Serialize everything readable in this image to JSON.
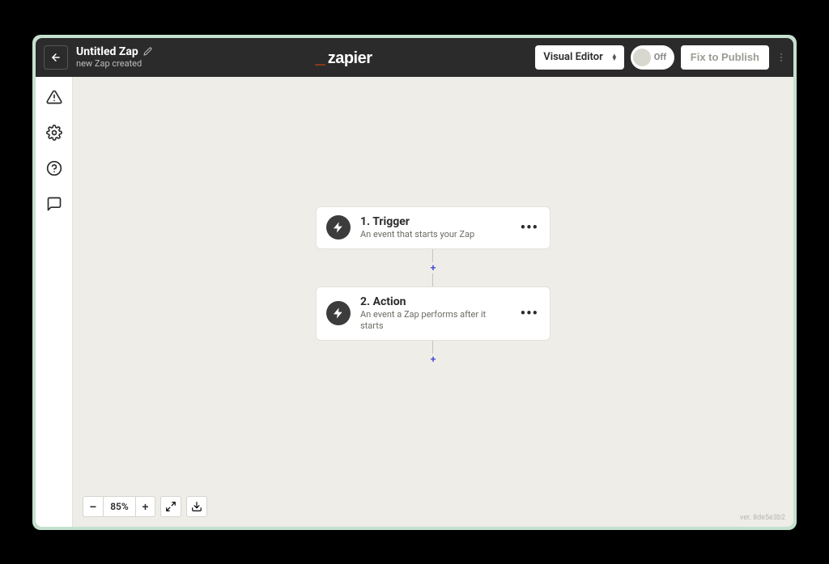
{
  "header": {
    "zap_title": "Untitled Zap",
    "zap_subtitle": "new Zap created",
    "editor_mode": "Visual Editor",
    "toggle_label": "Off",
    "publish_label": "Fix to Publish",
    "logo_text": "zapier"
  },
  "steps": [
    {
      "title": "1. Trigger",
      "desc": "An event that starts your Zap"
    },
    {
      "title": "2. Action",
      "desc": "An event a Zap performs after it starts"
    }
  ],
  "zoom": {
    "level": "85%"
  },
  "version": "ver. 8de5e3b2"
}
